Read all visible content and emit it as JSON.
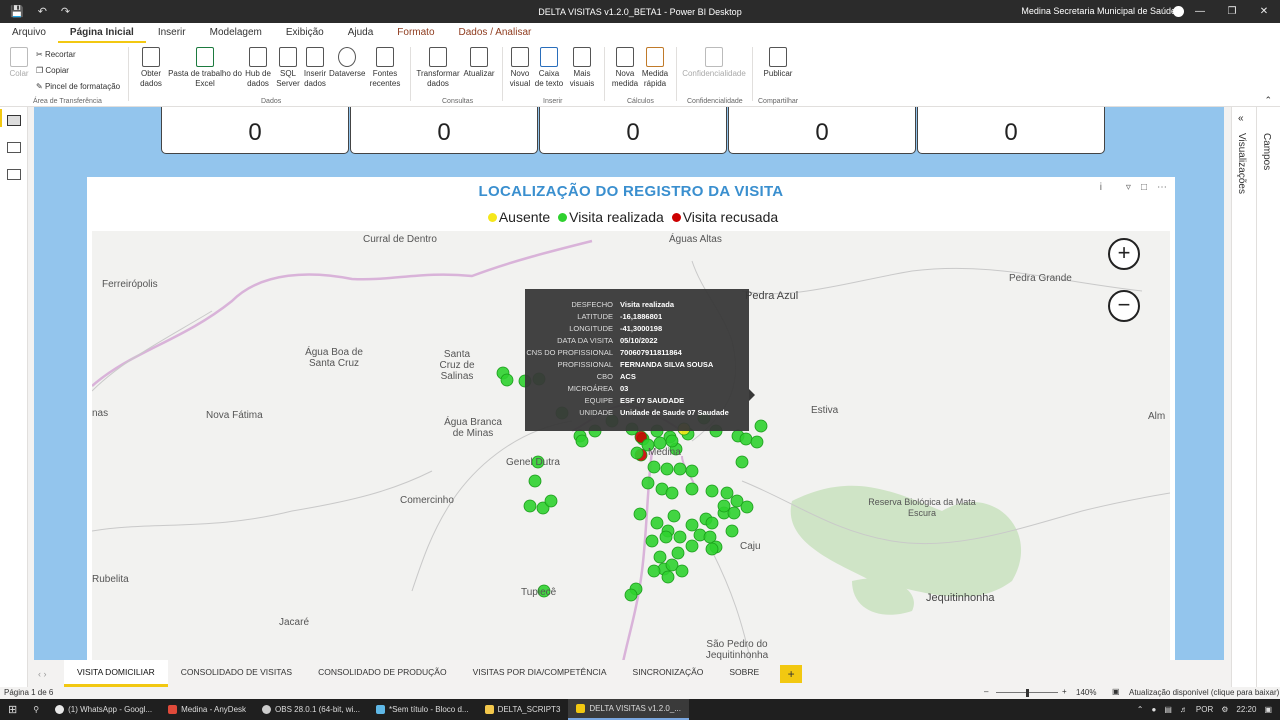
{
  "window": {
    "title": "DELTA VISITAS v1.2.0_BETA1 - Power BI Desktop",
    "user": "Medina Secretaria Municipal de Saúde"
  },
  "menu": {
    "tabs": [
      "Arquivo",
      "Página Inicial",
      "Inserir",
      "Modelagem",
      "Exibição",
      "Ajuda",
      "Formato",
      "Dados / Analisar"
    ],
    "active": "Página Inicial"
  },
  "ribbon": {
    "clipboard": {
      "paste": "Colar",
      "cut": "Recortar",
      "copy": "Copiar",
      "format_painter": "Pincel de formatação",
      "group": "Área de Transferência"
    },
    "data": {
      "get_data": "Obter dados",
      "excel": "Pasta de trabalho do Excel",
      "hub": "Hub de dados",
      "sql": "SQL Server",
      "enter": "Inserir dados",
      "dataverse": "Dataverse",
      "recent": "Fontes recentes",
      "group": "Dados"
    },
    "queries": {
      "transform": "Transformar dados",
      "refresh": "Atualizar",
      "group": "Consultas"
    },
    "insert": {
      "new_visual": "Novo visual",
      "textbox": "Caixa de texto",
      "more_visuals": "Mais visuais",
      "group": "Inserir"
    },
    "calc": {
      "new_measure": "Nova medida",
      "quick_measure": "Medida rápida",
      "group": "Cálculos"
    },
    "sensitivity": {
      "label": "Confidencialidade",
      "group": "Confidencialidade"
    },
    "share": {
      "publish": "Publicar",
      "group": "Compartilhar"
    }
  },
  "cards": [
    "0",
    "0",
    "0",
    "0",
    "0"
  ],
  "map": {
    "title": "LOCALIZAÇÃO DO REGISTRO DA VISITA",
    "legend": [
      {
        "label": "Ausente",
        "color": "#f5e71b"
      },
      {
        "label": "Visita realizada",
        "color": "#2fd12f"
      },
      {
        "label": "Visita recusada",
        "color": "#cc0000"
      }
    ],
    "zoom_in": "+",
    "zoom_out": "−",
    "places": [
      "Curral de Dentro",
      "Águas Altas",
      "Ferreirópolis",
      "Pedra Azul",
      "Pedra Grande",
      "Água Boa de Santa Cruz",
      "Santa Cruz de Salinas",
      "nas",
      "Nova Fátima",
      "Água Branca de Minas",
      "Estiva",
      "Alm",
      "Genel Dutra",
      "Medina",
      "Comercinho",
      "Reserva Biológica da Mata Escura",
      "Caju",
      "Rubelita",
      "Tupiecê",
      "Jequitinhonha",
      "Jacaré",
      "São Pedro do Jequitinhonha"
    ]
  },
  "tooltip": [
    {
      "k": "DESFECHO",
      "v": "Visita realizada"
    },
    {
      "k": "LATITUDE",
      "v": "-16,1886801"
    },
    {
      "k": "LONGITUDE",
      "v": "-41,3000198"
    },
    {
      "k": "DATA DA VISITA",
      "v": "05/10/2022"
    },
    {
      "k": "CNS DO PROFISSIONAL",
      "v": "700607911811864"
    },
    {
      "k": "PROFISSIONAL",
      "v": "FERNANDA SILVA SOUSA"
    },
    {
      "k": "CBO",
      "v": "ACS"
    },
    {
      "k": "MICROÁREA",
      "v": "03"
    },
    {
      "k": "EQUIPE",
      "v": "ESF 07 SAUDADE"
    },
    {
      "k": "UNIDADE",
      "v": "Unidade de Saude 07 Saudade"
    }
  ],
  "right_pane": {
    "visualizations": "Visualizações",
    "fields": "Campos"
  },
  "pages": [
    "VISITA DOMICILIAR",
    "CONSOLIDADO DE VISITAS",
    "CONSOLIDADO DE PRODUÇÃO",
    "VISITAS POR DIA/COMPETÊNCIA",
    "SINCRONIZAÇÃO",
    "SOBRE"
  ],
  "add_page": "+",
  "status": {
    "page": "Página 1 de 6",
    "zoom": "140%",
    "update": "Atualização disponível (clique para baixar)"
  },
  "taskbar": {
    "items": [
      {
        "label": "(1) WhatsApp - Googl...",
        "color": "#e8e8e8"
      },
      {
        "label": "Medina - AnyDesk",
        "color": "#e04a3a"
      },
      {
        "label": "OBS 28.0.1 (64-bit, wi...",
        "color": "#ccc"
      },
      {
        "label": "*Sem título - Bloco d...",
        "color": "#5fb8e6"
      },
      {
        "label": "DELTA_SCRIPT3",
        "color": "#f3c74b"
      },
      {
        "label": "DELTA VISITAS v1.2.0_...",
        "color": "#f2c811"
      }
    ],
    "lang": "POR",
    "time": "22:20"
  }
}
